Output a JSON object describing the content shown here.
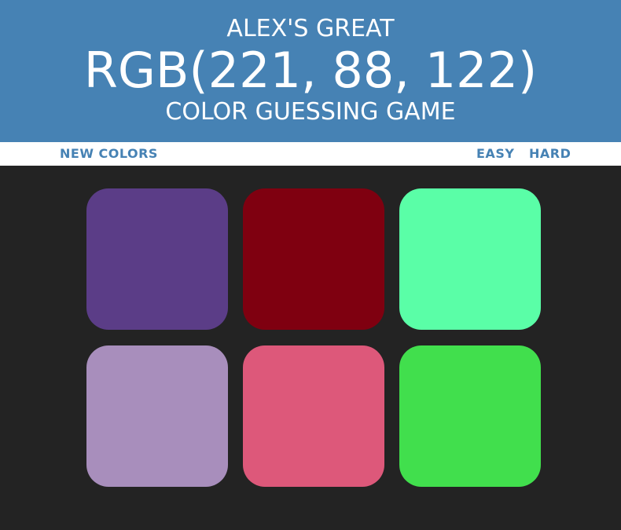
{
  "header": {
    "line1": "ALEX'S GREAT",
    "target_color": "RGB(221, 88, 122)",
    "line3": "COLOR GUESSING GAME",
    "background": "#4682b4"
  },
  "controls": {
    "new_colors_label": "NEW COLORS",
    "easy_label": "EASY",
    "hard_label": "HARD",
    "accent_color": "#4682b4"
  },
  "board": {
    "background": "#232323",
    "squares": [
      {
        "color": "#5b3d87"
      },
      {
        "color": "#7f0010"
      },
      {
        "color": "#5afea7"
      },
      {
        "color": "#a88ebc"
      },
      {
        "color": "#dd587a"
      },
      {
        "color": "#41df4d"
      }
    ]
  }
}
